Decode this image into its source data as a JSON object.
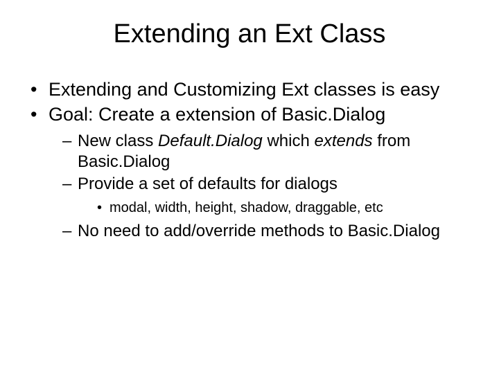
{
  "title": "Extending an Ext Class",
  "bullets": {
    "b1": "Extending and Customizing Ext classes is easy",
    "b2": "Goal: Create a extension of Basic.Dialog",
    "sub1_pre": "New class ",
    "sub1_default": "Default.Dialog",
    "sub1_mid": " which ",
    "sub1_extends": "extends",
    "sub1_post": " from Basic.Dialog",
    "sub2": "Provide a set of defaults for dialogs",
    "sub2_detail": "modal, width, height, shadow, draggable, etc",
    "sub3": "No need to add/override methods to Basic.Dialog"
  }
}
